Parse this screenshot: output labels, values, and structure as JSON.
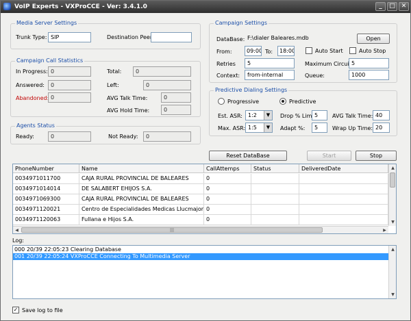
{
  "window": {
    "title": "VoIP Experts - VXProCCE - Ver: 3.4.1.0"
  },
  "media_server": {
    "group_label": "Media Server Settings",
    "trunk_type_label": "Trunk Type:",
    "trunk_type_value": "SIP",
    "destination_peer_label": "Destination Peer:",
    "destination_peer_value": ""
  },
  "stats": {
    "group_label": "Campaign Call Statistics",
    "in_progress_label": "In Progress:",
    "in_progress_value": "0",
    "answered_label": "Answered:",
    "answered_value": "0",
    "abandoned_label": "Abandoned:",
    "abandoned_value": "0",
    "total_label": "Total:",
    "total_value": "0",
    "left_label": "Left:",
    "left_value": "0",
    "avg_talk_label": "AVG Talk Time:",
    "avg_talk_value": "0",
    "avg_hold_label": "AVG Hold Time:",
    "avg_hold_value": "0"
  },
  "agents": {
    "group_label": "Agents Status",
    "ready_label": "Ready:",
    "ready_value": "0",
    "not_ready_label": "Not Ready:",
    "not_ready_value": "0"
  },
  "campaign": {
    "group_label": "Campaign Settings",
    "database_label": "DataBase:",
    "database_value": "F:\\dialer Baleares.mdb",
    "open_label": "Open",
    "from_label": "From:",
    "from_value": "09:00",
    "to_label": "To:",
    "to_value": "18:00",
    "auto_start_label": "Auto Start",
    "auto_stop_label": "Auto Stop",
    "retries_label": "Retries",
    "retries_value": "5",
    "max_circuits_label": "Maximum Circuits:",
    "max_circuits_value": "5",
    "context_label": "Context:",
    "context_value": "from-internal",
    "queue_label": "Queue:",
    "queue_value": "1000"
  },
  "predictive": {
    "group_label": "Predictive Dialing Settings",
    "progressive_label": "Progressive",
    "predictive_label": "Predictive",
    "est_asr_label": "Est. ASR:",
    "est_asr_value": "1:2",
    "drop_limit_label": "Drop % Limit",
    "drop_limit_value": "5",
    "avg_talk_label": "AVG Talk Time:",
    "avg_talk_value": "40",
    "max_asr_label": "Max. ASR:",
    "max_asr_value": "1:5",
    "adapt_label": "Adapt %:",
    "adapt_value": "5",
    "wrap_up_label": "Wrap Up Time:",
    "wrap_up_value": "20"
  },
  "actions": {
    "reset_label": "Reset DataBase",
    "start_label": "Start",
    "stop_label": "Stop"
  },
  "grid": {
    "columns": [
      "PhoneNumber",
      "Name",
      "CallAttemps",
      "Status",
      "DeliveredDate"
    ],
    "rows": [
      [
        "0034971011700",
        "CAJA RURAL PROVINCIAL DE BALEARES",
        "0",
        "",
        ""
      ],
      [
        "0034971014014",
        "DE SALABERT EHIJOS S.A.",
        "0",
        "",
        ""
      ],
      [
        "0034971069300",
        "CAJA RURAL PROVINCIAL DE BALEARES",
        "0",
        "",
        ""
      ],
      [
        "0034971120021",
        "Centro de Especialidades Medicas Llucmajor S.L.",
        "0",
        "",
        ""
      ],
      [
        "0034971120063",
        "Fullana e Hijos S.A.",
        "0",
        "",
        ""
      ]
    ],
    "scroll_mark": "|||"
  },
  "log": {
    "label": "Log:",
    "lines": [
      "000 20/39 22:05:23 Clearing Database",
      "001 20/39 22:05:24 VXProCCE Connecting To Multimedia Server"
    ],
    "selected_index": 1
  },
  "footer": {
    "save_log_label": "Save log to file",
    "save_log_checked": true
  },
  "glyphs": {
    "check": "✓",
    "combo_arrow": "▼",
    "up": "▲",
    "down": "▼",
    "left": "◀",
    "right": "▶",
    "minimize": "_",
    "maximize": "□",
    "close": "✕"
  }
}
